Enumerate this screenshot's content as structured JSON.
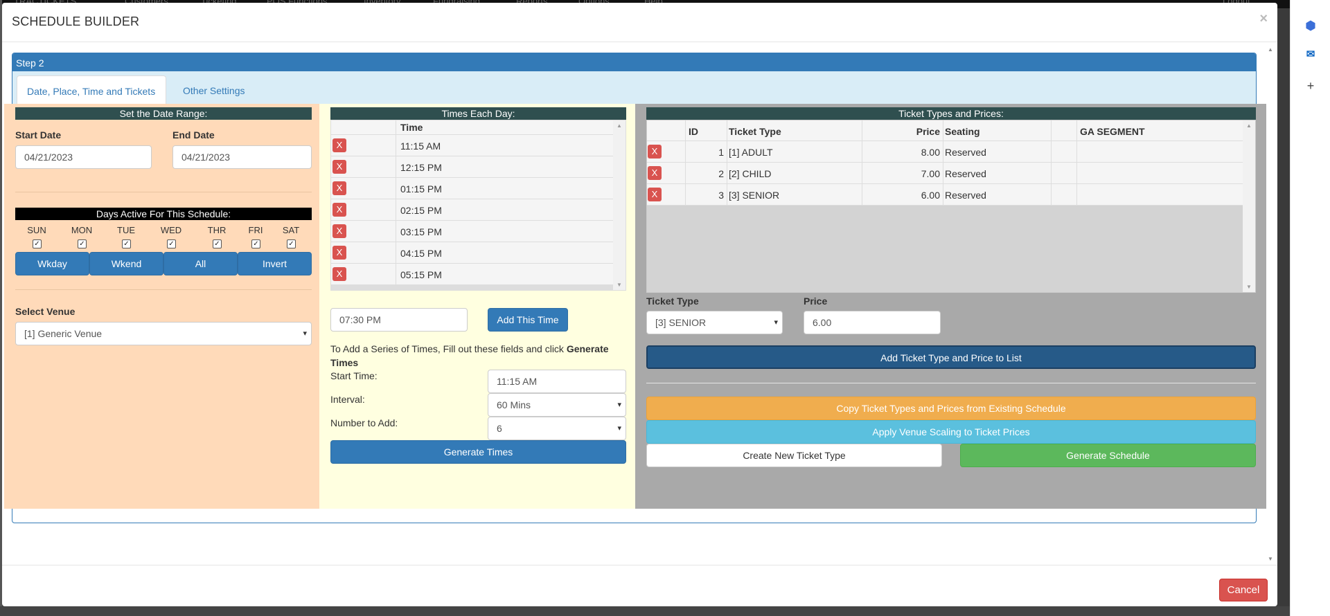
{
  "background_nav": [
    "TRACTICKETS",
    "Customers",
    "Ticketing",
    "POS Functions",
    "Inventory",
    "Fundraising",
    "Reports",
    "Options",
    "Help",
    "Logout"
  ],
  "modal": {
    "title": "SCHEDULE BUILDER",
    "close": "×",
    "step_heading": "Step 2",
    "tabs": [
      "Date, Place, Time and Tickets",
      "Other Settings"
    ],
    "cancel_label": "Cancel"
  },
  "date_range": {
    "heading": "Set the Date Range:",
    "start_label": "Start Date",
    "start_value": "04/21/2023",
    "end_label": "End Date",
    "end_value": "04/21/2023"
  },
  "days": {
    "heading": "Days Active For This Schedule:",
    "names": [
      "SUN",
      "MON",
      "TUE",
      "WED",
      "THR",
      "FRI",
      "SAT"
    ],
    "buttons": [
      "Wkday",
      "Wkend",
      "All",
      "Invert"
    ]
  },
  "venue": {
    "label": "Select Venue",
    "value": "[1] Generic Venue"
  },
  "times": {
    "heading": "Times Each Day:",
    "column_header": "Time",
    "remove_label": "X",
    "rows": [
      "11:15 AM",
      "12:15 PM",
      "01:15 PM",
      "02:15 PM",
      "03:15 PM",
      "04:15 PM",
      "05:15 PM"
    ],
    "new_time_value": "07:30 PM",
    "add_button": "Add This Time",
    "series_text": "To Add a Series of Times, Fill out these fields and click",
    "series_bold": "Generate Times",
    "start_time_label": "Start Time:",
    "start_time_value": "11:15 AM",
    "interval_label": "Interval:",
    "interval_value": "60 Mins",
    "number_label": "Number to Add:",
    "number_value": "6",
    "generate_button": "Generate Times"
  },
  "tickets": {
    "heading": "Ticket Types and Prices:",
    "columns": [
      "ID",
      "Ticket Type",
      "Price",
      "Seating",
      "GA SEGMENT"
    ],
    "remove_label": "X",
    "rows": [
      {
        "id": "1",
        "type": "[1] ADULT",
        "price": "8.00",
        "seating": "Reserved"
      },
      {
        "id": "2",
        "type": "[2] CHILD",
        "price": "7.00",
        "seating": "Reserved"
      },
      {
        "id": "3",
        "type": "[3] SENIOR",
        "price": "6.00",
        "seating": "Reserved"
      }
    ],
    "type_label": "Ticket Type",
    "type_value": "[3] SENIOR",
    "price_label": "Price",
    "price_value": "6.00",
    "add_button": "Add Ticket Type and Price to List",
    "copy_button": "Copy Ticket Types and Prices from Existing Schedule",
    "scaling_button": "Apply Venue Scaling to Ticket Prices",
    "create_button": "Create New Ticket Type",
    "generate_button": "Generate Schedule"
  },
  "colors": {
    "primary": "#337ab7",
    "danger": "#d9534f",
    "warning": "#f0ad4e",
    "info": "#5bc0de",
    "success": "#5cb85c",
    "date_bg": "#ffdab9",
    "times_bg": "#ffffe0",
    "tickets_bg": "#a9a9a9"
  }
}
